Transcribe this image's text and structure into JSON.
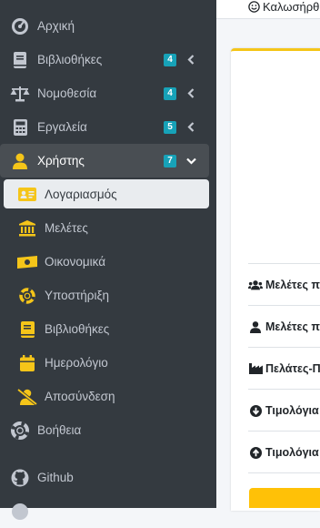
{
  "sidebar": {
    "items": [
      {
        "label": "Αρχική",
        "icon": "dashboard-gauge-icon"
      },
      {
        "label": "Βιβλιοθήκες",
        "icon": "book-icon",
        "badge": "4"
      },
      {
        "label": "Νομοθεσία",
        "icon": "balance-scale-icon",
        "badge": "4"
      },
      {
        "label": "Εργαλεία",
        "icon": "calculator-icon",
        "badge": "5"
      },
      {
        "label": "Χρήστης",
        "icon": "user-icon",
        "badge": "7"
      }
    ],
    "submenu": [
      {
        "label": "Λογαριασμός",
        "icon": "id-card-icon"
      },
      {
        "label": "Μελέτες",
        "icon": "landmark-icon"
      },
      {
        "label": "Οικονομικά",
        "icon": "money-bill-icon"
      },
      {
        "label": "Υποστήριξη",
        "icon": "life-ring-icon"
      },
      {
        "label": "Βιβλιοθήκες",
        "icon": "book-icon"
      },
      {
        "label": "Ημερολόγιο",
        "icon": "calendar-icon"
      },
      {
        "label": "Αποσύνδεση",
        "icon": "user-slash-icon"
      }
    ],
    "help": {
      "label": "Βοήθεια",
      "icon": "life-ring-icon"
    },
    "github": {
      "label": "Github",
      "icon": "github-icon"
    }
  },
  "header": {
    "greeting": "Καλωσήρθ"
  },
  "main": {
    "rows": [
      {
        "label": "Μελέτες π",
        "icon": "users-icon"
      },
      {
        "label": "Μελέτες πε",
        "icon": "user-icon"
      },
      {
        "label": "Πελάτες-Π",
        "icon": "industry-icon"
      },
      {
        "label": "Τιμολόγια",
        "icon": "arrow-circle-down-icon"
      },
      {
        "label": "Τιμολόγια",
        "icon": "arrow-circle-up-icon"
      }
    ]
  },
  "colors": {
    "sidebar_bg": "#343a40",
    "accent": "#f5c519",
    "badge": "#17a2b8",
    "active_bg": "#e9ecef"
  }
}
